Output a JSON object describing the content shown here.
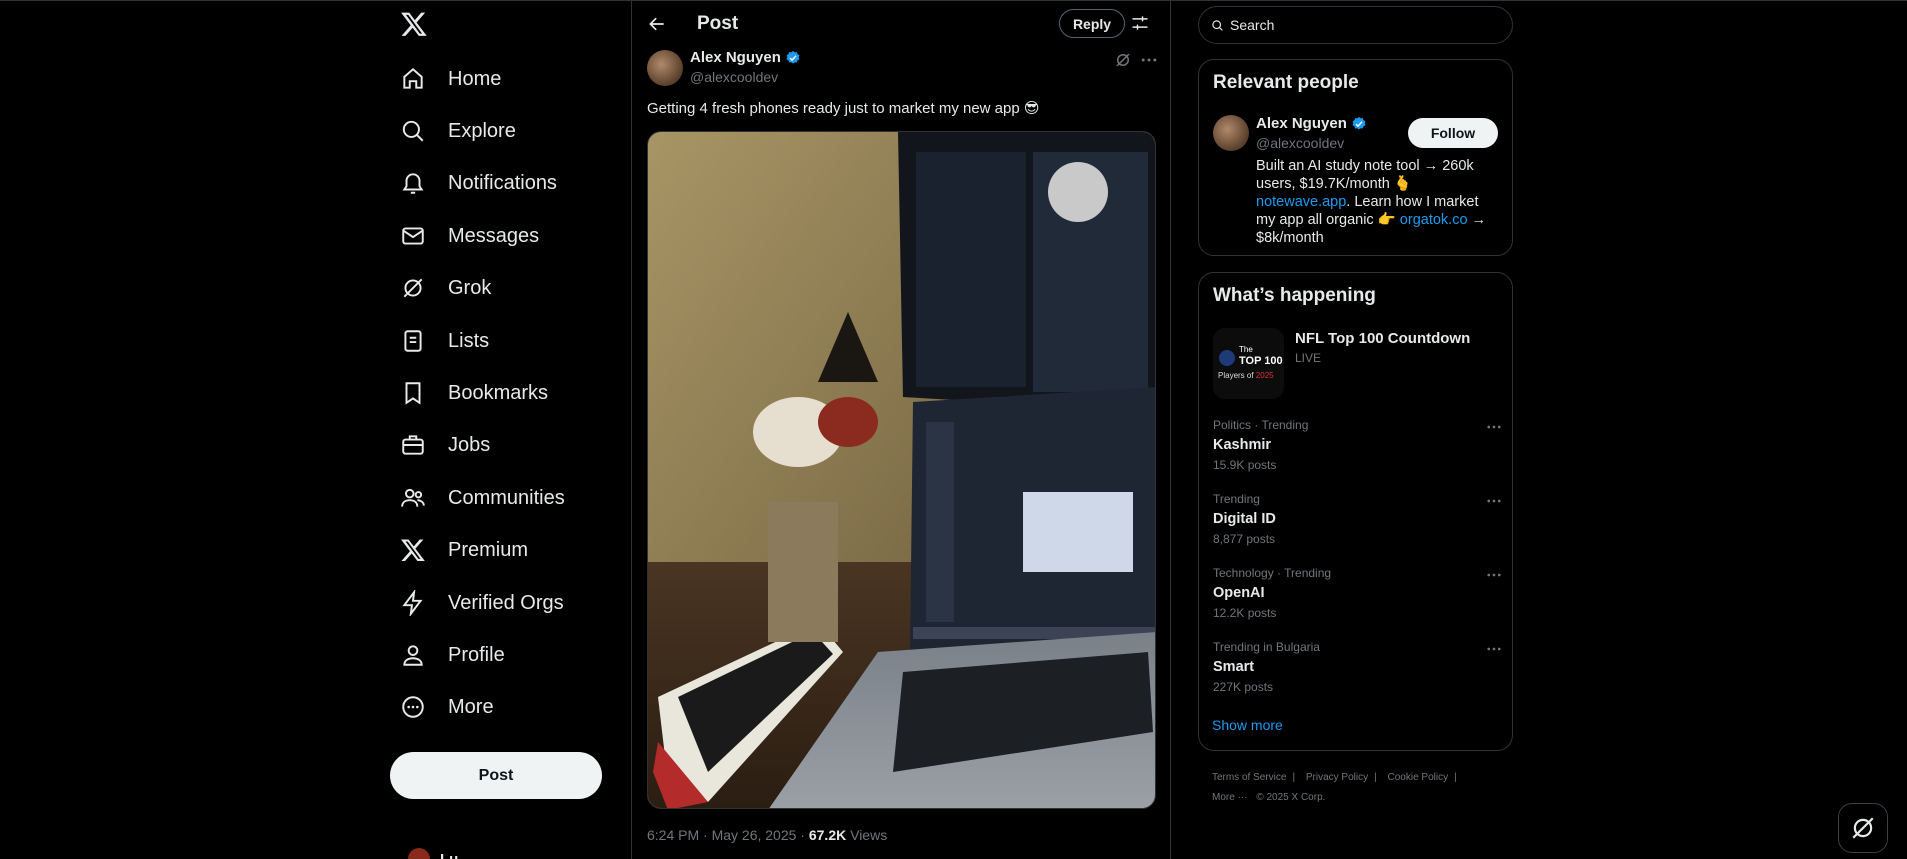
{
  "nav": {
    "items": [
      {
        "label": "Home",
        "icon": "home-icon"
      },
      {
        "label": "Explore",
        "icon": "search-icon"
      },
      {
        "label": "Notifications",
        "icon": "bell-icon"
      },
      {
        "label": "Messages",
        "icon": "envelope-icon"
      },
      {
        "label": "Grok",
        "icon": "grok-icon"
      },
      {
        "label": "Lists",
        "icon": "list-icon"
      },
      {
        "label": "Bookmarks",
        "icon": "bookmark-icon"
      },
      {
        "label": "Jobs",
        "icon": "briefcase-icon"
      },
      {
        "label": "Communities",
        "icon": "people-icon"
      },
      {
        "label": "Premium",
        "icon": "x-logo-icon"
      },
      {
        "label": "Verified Orgs",
        "icon": "lightning-icon"
      },
      {
        "label": "Profile",
        "icon": "person-icon"
      },
      {
        "label": "More",
        "icon": "more-circle-icon"
      }
    ],
    "post_button": "Post",
    "account_peek": "Lu..."
  },
  "post": {
    "header_title": "Post",
    "reply_label": "Reply",
    "author_name": "Alex Nguyen",
    "author_handle": "@alexcooldev",
    "text": "Getting 4 fresh phones ready just to market my new app 😎",
    "time": "6:24 PM · May 26, 2025 · ",
    "views_count": "67.2K",
    "views_label": " Views"
  },
  "search": {
    "placeholder": "Search"
  },
  "relevant": {
    "title": "Relevant people",
    "name": "Alex Nguyen",
    "handle": "@alexcooldev",
    "follow_label": "Follow",
    "bio_1": "Built an AI study note tool → 260k users, $19.7K/month 🫰 ",
    "bio_link1": "notewave.app",
    "bio_2": ". Learn how I market my app all organic 👉 ",
    "bio_link2": "orgatok.co",
    "bio_3": " → $8k/month"
  },
  "happening": {
    "title": "What’s happening",
    "feature_title": "NFL Top 100 Countdown",
    "feature_sub": "LIVE",
    "thumb_line1": "The",
    "thumb_line2": "TOP 100",
    "thumb_line3": "Players of ",
    "thumb_year": "2025",
    "trends": [
      {
        "context": "Politics · Trending",
        "name": "Kashmir",
        "count": "15.9K posts"
      },
      {
        "context": "Trending",
        "name": "Digital ID",
        "count": "8,877 posts"
      },
      {
        "context": "Technology · Trending",
        "name": "OpenAI",
        "count": "12.2K posts"
      },
      {
        "context": "Trending in Bulgaria",
        "name": "Smart",
        "count": "227K posts"
      }
    ],
    "show_more": "Show more"
  },
  "footer": {
    "terms": "Terms of Service",
    "privacy": "Privacy Policy",
    "cookie": "Cookie Policy",
    "more": "More ···",
    "copyright": "© 2025 X Corp."
  },
  "colors": {
    "accent": "#1d9bf0",
    "background": "#000000",
    "border": "#2f3336",
    "muted": "#71767b"
  }
}
